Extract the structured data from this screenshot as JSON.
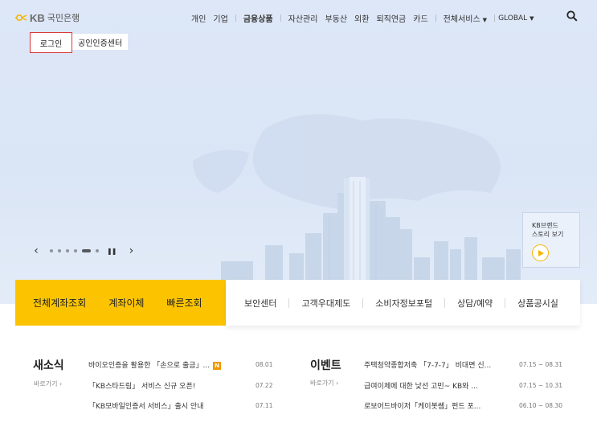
{
  "header": {
    "logo_text": "KB",
    "logo_bank": "국민은행",
    "nav_primary": [
      "개인",
      "기업"
    ],
    "nav_products": "금융상품",
    "nav_secondary": [
      "자산관리",
      "부동산",
      "외환",
      "퇴직연금",
      "카드"
    ],
    "all_services": "전체서비스",
    "global": "GLOBAL"
  },
  "login": {
    "login_label": "로그인",
    "cert_label": "공인인증센터"
  },
  "brand_story": {
    "line1": "KB브랜드",
    "line2": "스토리 보기"
  },
  "slider": {
    "dot_count": 6,
    "active_index": 4
  },
  "quick_primary": [
    "전체계좌조회",
    "계좌이체",
    "빠른조회"
  ],
  "quick_secondary": [
    "보안센터",
    "고객우대제도",
    "소비자정보포털",
    "상담/예약",
    "상품공시실"
  ],
  "news": {
    "title": "새소식",
    "more": "바로가기 ›",
    "items": [
      {
        "title": "바이오인증을 활용한 「손으로 출금」...",
        "date": "08.01",
        "badge": "N"
      },
      {
        "title": "「KB스타드림」 서비스 신규 오픈!",
        "date": "07.22"
      },
      {
        "title": "「KB모바일인증서 서비스」출시 안내",
        "date": "07.11"
      }
    ]
  },
  "events": {
    "title": "이벤트",
    "more": "바로가기 ›",
    "items": [
      {
        "title": "주택청약종합저축 「7-7-7」 비대면 신...",
        "date": "07.15 ~ 08.31"
      },
      {
        "title": "급여이체에 대한 낯선 고민~ KB와 ...",
        "date": "07.15 ~ 10.31"
      },
      {
        "title": "로보어드바이저「케이봇쌤」펀드 포...",
        "date": "06.10 ~ 08.30"
      }
    ]
  },
  "colors": {
    "accent_yellow": "#fcc400",
    "login_border": "#d9383a",
    "badge_orange": "#f39800"
  }
}
